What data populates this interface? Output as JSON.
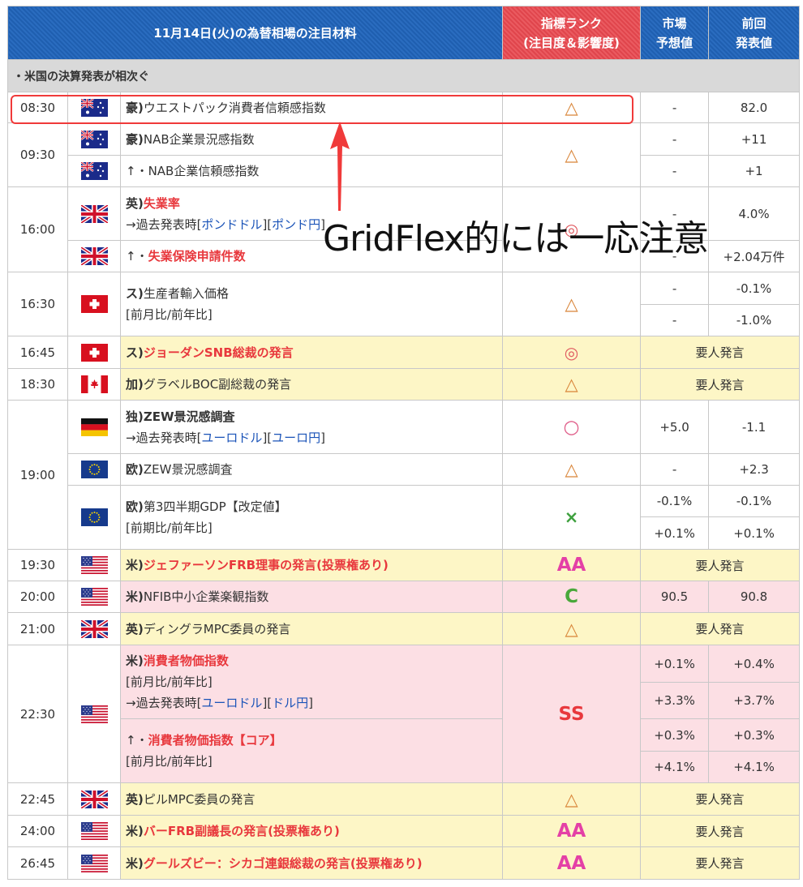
{
  "header": {
    "title": "11月14日(火)の為替相場の注目材料",
    "rank_line1": "指標ランク",
    "rank_line2": "(注目度＆影響度)",
    "forecast_line1": "市場",
    "forecast_line2": "予想値",
    "previous_line1": "前回",
    "previous_line2": "発表値"
  },
  "section": {
    "label": "・米国の決算発表が相次ぐ"
  },
  "rows": {
    "r0830": {
      "time": "08:30",
      "country": "豪)",
      "name": "ウエストパック消費者信頼感指数",
      "rank": "△",
      "forecast": "-",
      "previous": "82.0"
    },
    "r0930": {
      "time": "09:30",
      "rank": "△",
      "e1": {
        "country": "豪)",
        "name": "NAB企業景況感指数",
        "forecast": "-",
        "previous": "+11"
      },
      "e2": {
        "prefix": "↑・",
        "name": "NAB企業信頼感指数",
        "forecast": "-",
        "previous": "+1"
      }
    },
    "r1600": {
      "time": "16:00",
      "rank": "◎",
      "e1": {
        "country": "英)",
        "name": "失業率",
        "past_prefix": "→過去発表時[",
        "link1": "ポンドドル",
        "mid": "][",
        "link2": "ポンド円",
        "suffix": "]",
        "forecast": "-",
        "previous": "4.0%"
      },
      "e2": {
        "prefix": "↑・",
        "name": "失業保険申請件数",
        "forecast": "-",
        "previous": "+2.04万件"
      }
    },
    "r1630": {
      "time": "16:30",
      "country": "ス)",
      "name": "生産者輸入価格",
      "sub": "[前月比/前年比]",
      "rank": "△",
      "forecast1": "-",
      "previous1": "-0.1%",
      "forecast2": "-",
      "previous2": "-1.0%"
    },
    "r1645": {
      "time": "16:45",
      "country": "ス)",
      "name": "ジョーダンSNB総裁の発言",
      "rank": "◎",
      "speech": "要人発言"
    },
    "r1830": {
      "time": "18:30",
      "country": "加)",
      "name": "グラベルBOC副総裁の発言",
      "rank": "△",
      "speech": "要人発言"
    },
    "r1900": {
      "time": "19:00",
      "e1": {
        "country": "独)",
        "name": "ZEW景況感調査",
        "past_prefix": "→過去発表時[",
        "link1": "ユーロドル",
        "mid": "][",
        "link2": "ユーロ円",
        "suffix": "]",
        "rank": "○",
        "forecast": "+5.0",
        "previous": "-1.1"
      },
      "e2": {
        "country": "欧)",
        "name": "ZEW景況感調査",
        "rank": "△",
        "forecast": "-",
        "previous": "+2.3"
      },
      "e3": {
        "country": "欧)",
        "name": "第3四半期GDP【改定値】",
        "sub": "[前期比/前年比]",
        "rank": "×",
        "forecast1": "-0.1%",
        "previous1": "-0.1%",
        "forecast2": "+0.1%",
        "previous2": "+0.1%"
      }
    },
    "r1930": {
      "time": "19:30",
      "country": "米)",
      "name": "ジェファーソンFRB理事の発言(投票権あり)",
      "rank": "AA",
      "speech": "要人発言"
    },
    "r2000": {
      "time": "20:00",
      "country": "米)",
      "name": "NFIB中小企業楽観指数",
      "rank": "C",
      "forecast": "90.5",
      "previous": "90.8"
    },
    "r2100": {
      "time": "21:00",
      "country": "英)",
      "name": "ディングラMPC委員の発言",
      "rank": "△",
      "speech": "要人発言"
    },
    "r2230": {
      "time": "22:30",
      "rank": "SS",
      "e1": {
        "country": "米)",
        "name": "消費者物価指数",
        "sub": "[前月比/前年比]",
        "past_prefix": "→過去発表時[",
        "link1": "ユーロドル",
        "mid": "][",
        "link2": "ドル円",
        "suffix": "]",
        "forecast1": "+0.1%",
        "previous1": "+0.4%",
        "forecast2": "+3.3%",
        "previous2": "+3.7%"
      },
      "e2": {
        "prefix": "↑・",
        "name": "消費者物価指数【コア】",
        "sub": "[前月比/前年比]",
        "forecast1": "+0.3%",
        "previous1": "+0.3%",
        "forecast2": "+4.1%",
        "previous2": "+4.1%"
      }
    },
    "r2245": {
      "time": "22:45",
      "country": "英)",
      "name": "ピルMPC委員の発言",
      "rank": "△",
      "speech": "要人発言"
    },
    "r2400": {
      "time": "24:00",
      "country": "米)",
      "name": "バーFRB副議長の発言(投票権あり)",
      "rank": "AA",
      "speech": "要人発言"
    },
    "r2645": {
      "time": "26:45",
      "country": "米)",
      "name": "グールズビー：シカゴ連銀総裁の発言(投票権あり)",
      "rank": "AA",
      "speech": "要人発言"
    }
  },
  "annotation": {
    "text": "GridFlex的には一応注意",
    "highlight_color": "#f03a3a"
  },
  "colors": {
    "header_blue": "#2266b6",
    "header_red": "#e8474d",
    "yellow_row": "#fdf6c6",
    "pink_row": "#fcdfe4",
    "hot_text": "#e8383d",
    "link_text": "#1a53b8"
  }
}
